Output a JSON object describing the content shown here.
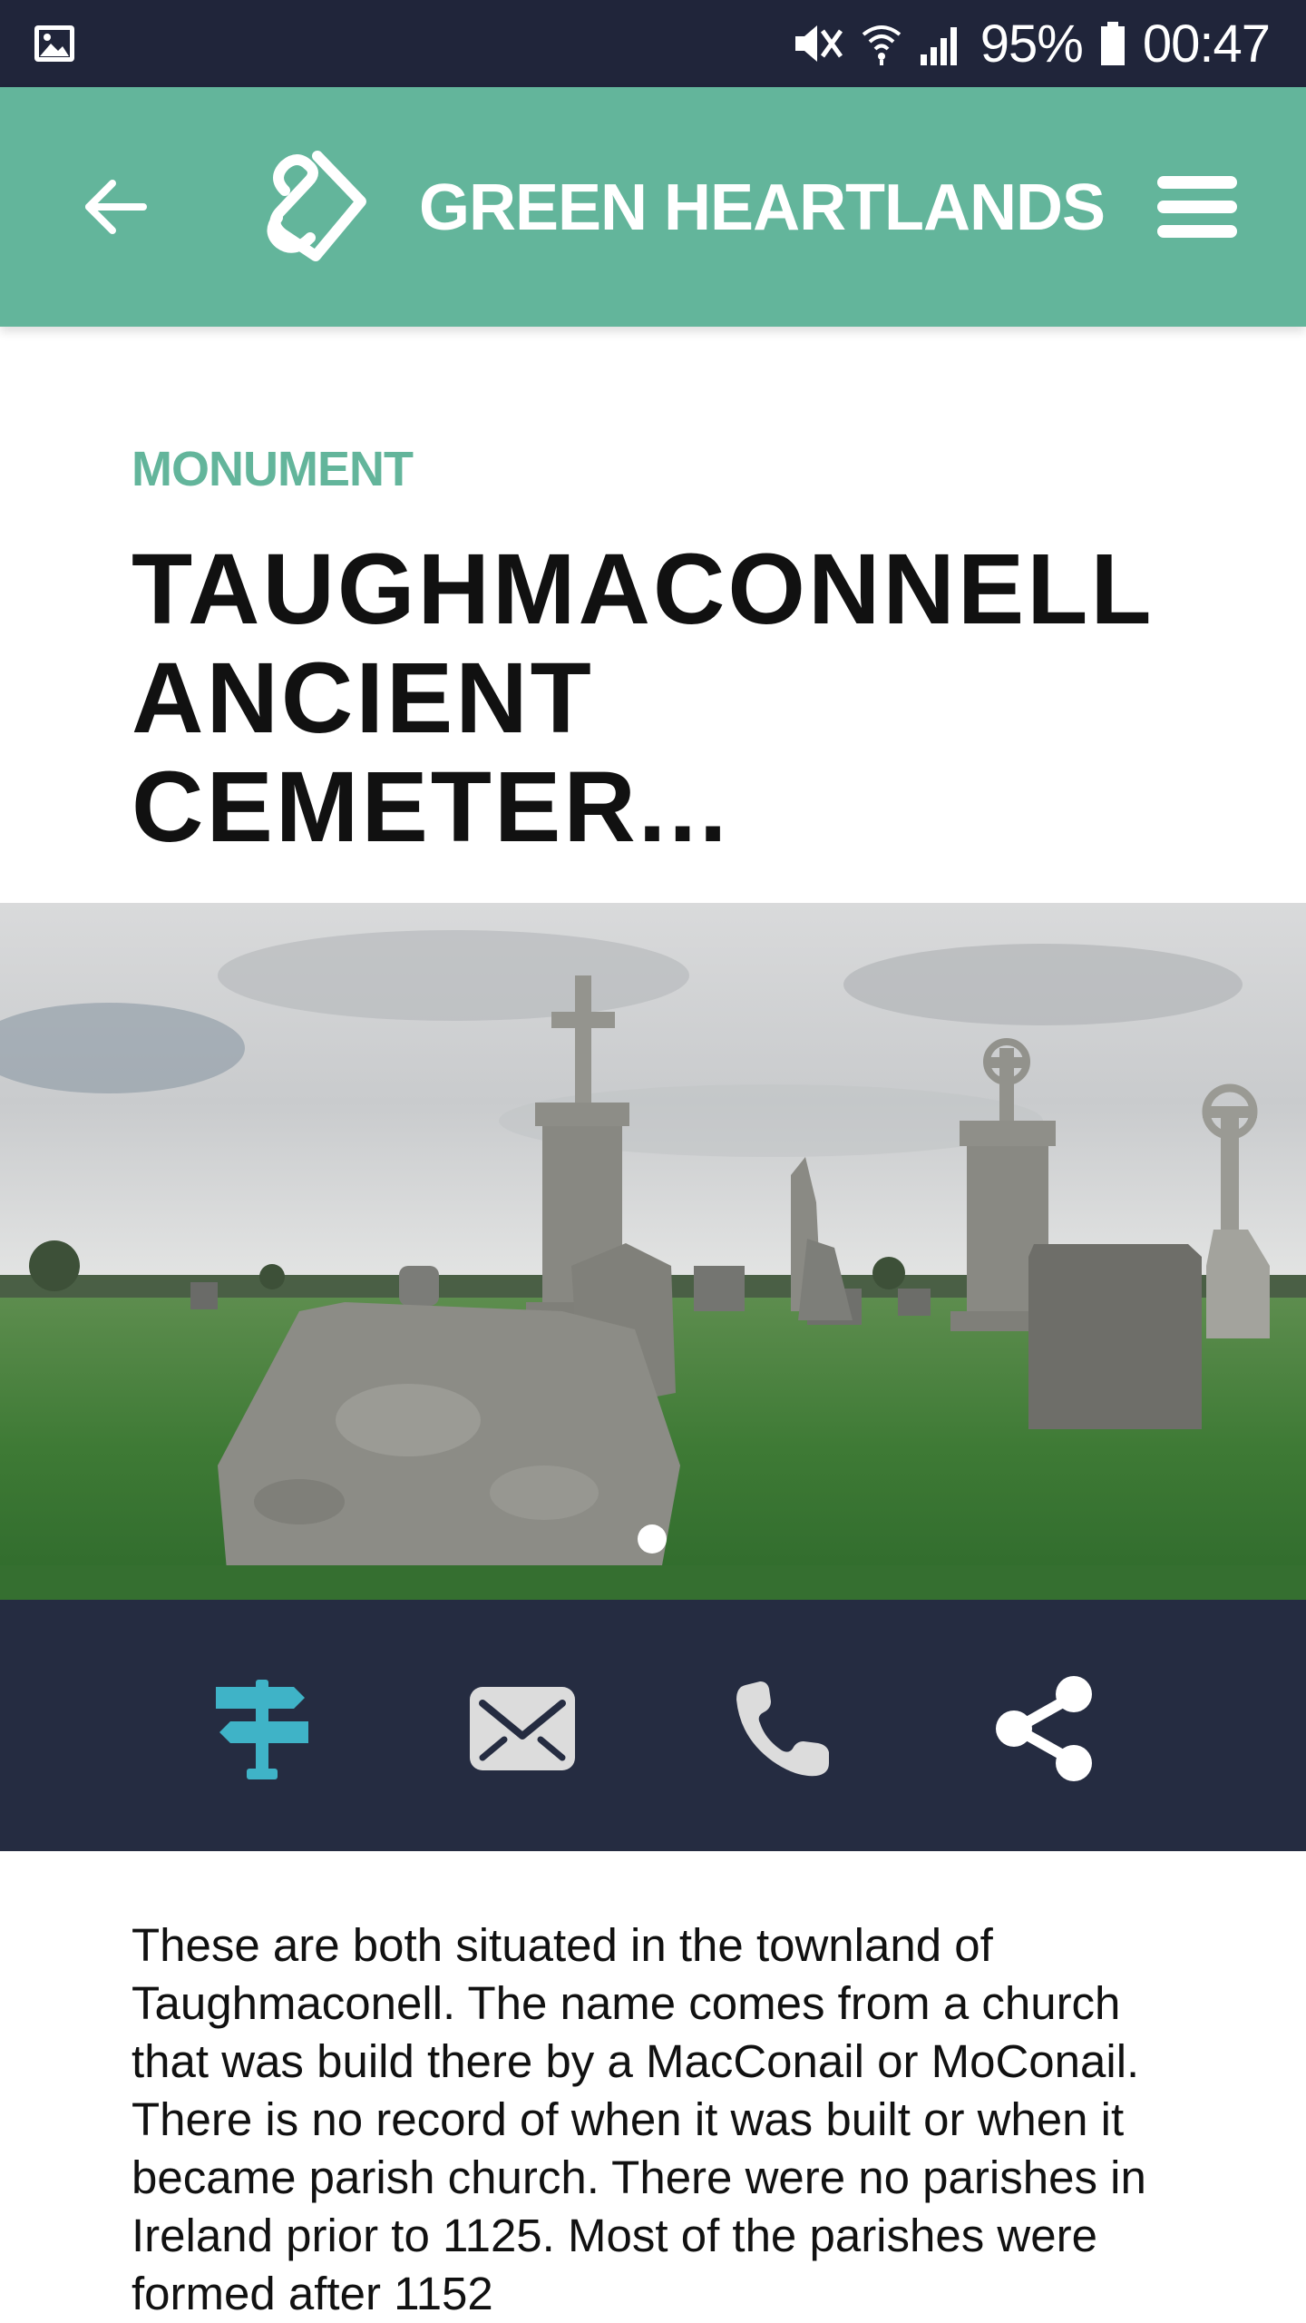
{
  "status_bar": {
    "battery": "95%",
    "time": "00:47",
    "icons": [
      "image-notification-icon",
      "mute-icon",
      "wifi-icon",
      "signal-icon",
      "battery-icon"
    ]
  },
  "header": {
    "brand": "GREEN HEARTLANDS",
    "back_icon": "back-arrow-icon",
    "menu_icon": "hamburger-menu-icon",
    "background_color": "#63b59b"
  },
  "content": {
    "category": "MONUMENT",
    "title_line1": "TAUGHMACONNELL",
    "title_line2": "ANCIENT CEMETER..."
  },
  "carousel": {
    "current_slide": 1,
    "total_slides": 1
  },
  "actions": [
    {
      "name": "directions",
      "icon": "signpost-icon",
      "color": "#3fb3c7"
    },
    {
      "name": "email",
      "icon": "mail-icon",
      "color": "#dcdcdc"
    },
    {
      "name": "call",
      "icon": "phone-icon",
      "color": "#dcdcdc"
    },
    {
      "name": "share",
      "icon": "share-icon",
      "color": "#ffffff"
    }
  ],
  "description": "These are both situated in the townland of Taughmaconell. The name comes from a church that was build there by a MacConail or MoConail. There is no record of when it was built or when it became parish church. There were no parishes in Ireland prior to 1125. Most of the parishes were formed after 1152"
}
